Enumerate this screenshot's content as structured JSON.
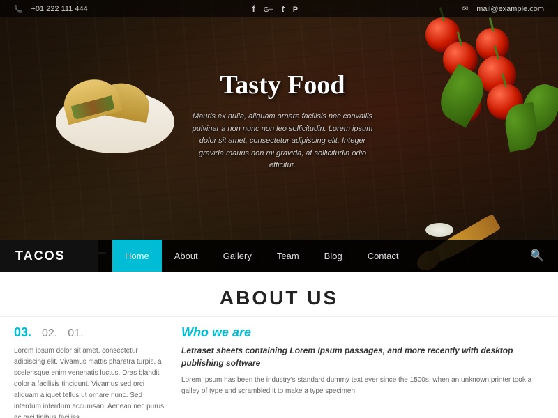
{
  "topbar": {
    "phone": "+01 222 111 444",
    "email": "mail@example.com",
    "social": [
      "f",
      "G+",
      "t",
      "P"
    ]
  },
  "hero": {
    "title": "Tasty Food",
    "description": "Mauris ex nulla, aliquam ornare facilisis nec convallis pulvinar a non nunc non\nleo sollicitudin. Lorem ipsum dolor sit amet, consectetur adipiscing elit.\nInteger gravida mauris non mi gravida, at sollicitudin odio efficitur."
  },
  "navbar": {
    "brand": "TACOS",
    "links": [
      {
        "label": "Home",
        "active": true
      },
      {
        "label": "About",
        "active": false
      },
      {
        "label": "Gallery",
        "active": false
      },
      {
        "label": "Team",
        "active": false
      },
      {
        "label": "Blog",
        "active": false
      },
      {
        "label": "Contact",
        "active": false
      }
    ],
    "search_label": "🔍"
  },
  "about": {
    "title": "ABOUT US",
    "numbers": {
      "active": "03.",
      "second": "02.",
      "third": "01."
    },
    "left_text": "Lorem ipsum dolor sit amet, consectetur adipiscing elit. Vivamus mattis pharetra turpis, a scelerisque enim venenatis luctus. Dras blandit dolor a facilisis tincidunt. Vivamus sed orci aliquam aliquet tellus ut ornare nunc. Sed interdum interdum accumsan. Aenean nec purus ac orci finibus faciliss.",
    "who_we_are": "Who we are",
    "italic_desc": "Letraset sheets containing Lorem Ipsum passages, and more recently with desktop publishing software",
    "body_text": "Lorem Ipsum has been the industry's standard dummy text ever since the 1500s, when an unknown printer took a galley of type and scrambled it to make a type specimen"
  },
  "colors": {
    "accent": "#00bcd4",
    "brand_bg": "#111111",
    "navbar_bg": "rgba(0,0,0,0.85)"
  }
}
